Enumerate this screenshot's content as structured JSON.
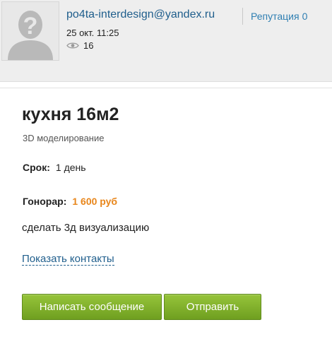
{
  "colors": {
    "link": "#1f5e8c",
    "reputation": "#2f7fb2",
    "fee": "#e8861b",
    "button_green": "#7aad28"
  },
  "author": {
    "avatar_icon": "avatar-placeholder-icon",
    "name": "po4ta-interdesign@yandex.ru",
    "reputation_label": "Репутация",
    "reputation_value": "0",
    "date": "25 окт. 11:25",
    "views_icon": "eye-icon",
    "views": "16"
  },
  "project": {
    "title": "кухня 16м2",
    "category": "3D моделирование",
    "term_label": "Срок:",
    "term_value": "1 день",
    "fee_label": "Гонорар:",
    "fee_value": "1 600 руб",
    "description": "сделать 3д визуализацию",
    "contacts_link": "Показать контакты"
  },
  "buttons": {
    "message": "Написать сообщение",
    "send": "Отправить"
  }
}
